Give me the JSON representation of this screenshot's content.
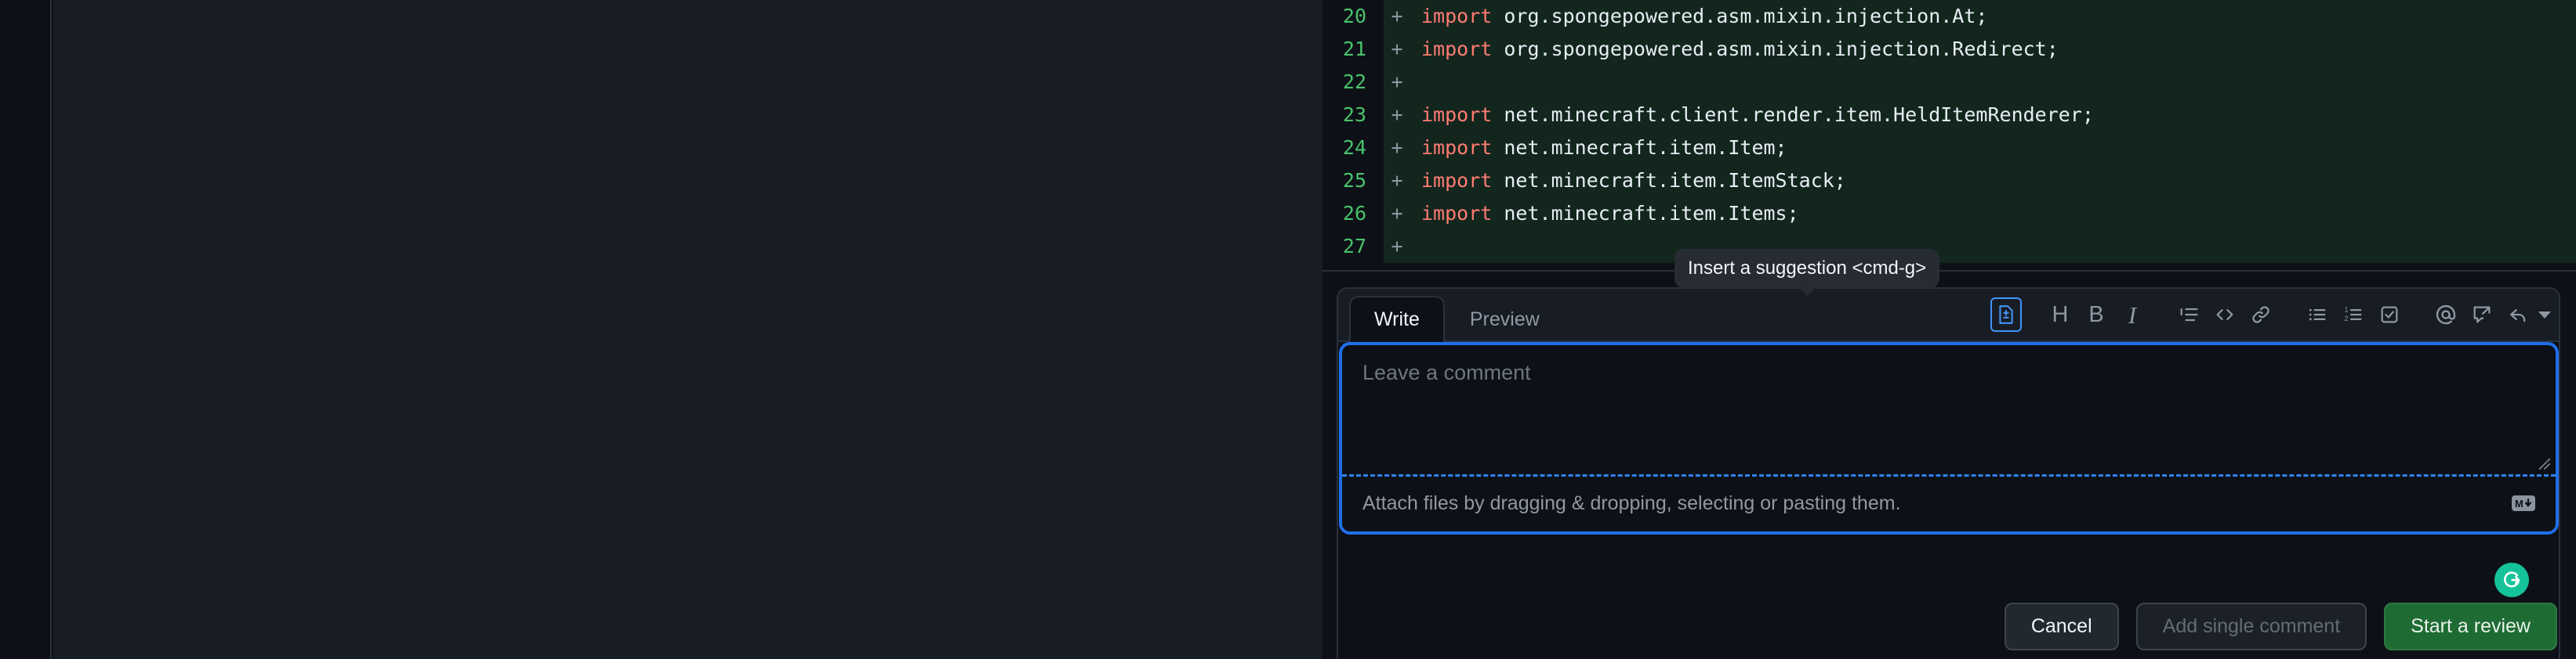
{
  "diff": {
    "lines": [
      {
        "num": "20",
        "marker": "+",
        "keyword": "import",
        "rest": " org.spongepowered.asm.mixin.injection.At;"
      },
      {
        "num": "21",
        "marker": "+",
        "keyword": "import",
        "rest": " org.spongepowered.asm.mixin.injection.Redirect;"
      },
      {
        "num": "22",
        "marker": "+",
        "keyword": "",
        "rest": ""
      },
      {
        "num": "23",
        "marker": "+",
        "keyword": "import",
        "rest": " net.minecraft.client.render.item.HeldItemRenderer;"
      },
      {
        "num": "24",
        "marker": "+",
        "keyword": "import",
        "rest": " net.minecraft.item.Item;"
      },
      {
        "num": "25",
        "marker": "+",
        "keyword": "import",
        "rest": " net.minecraft.item.ItemStack;"
      },
      {
        "num": "26",
        "marker": "+",
        "keyword": "import",
        "rest": " net.minecraft.item.Items;"
      },
      {
        "num": "27",
        "marker": "+",
        "keyword": "",
        "rest": ""
      }
    ]
  },
  "tooltip": {
    "text": "Insert a suggestion <cmd-g>"
  },
  "comment_form": {
    "tabs": [
      {
        "label": "Write",
        "active": true
      },
      {
        "label": "Preview",
        "active": false
      }
    ],
    "toolbar": [
      {
        "name": "insert-suggestion-icon",
        "title": "Insert a suggestion",
        "glyph": "suggestion"
      },
      {
        "name": "heading-icon",
        "title": "Heading",
        "glyph": "H"
      },
      {
        "name": "bold-icon",
        "title": "Bold",
        "glyph": "B"
      },
      {
        "name": "italic-icon",
        "title": "Italic",
        "glyph": "I"
      },
      {
        "name": "quote-icon",
        "title": "Quote",
        "glyph": "quote"
      },
      {
        "name": "code-icon",
        "title": "Code",
        "glyph": "code"
      },
      {
        "name": "link-icon",
        "title": "Link",
        "glyph": "link"
      },
      {
        "name": "unordered-list-icon",
        "title": "Unordered list",
        "glyph": "ul"
      },
      {
        "name": "ordered-list-icon",
        "title": "Numbered list",
        "glyph": "ol"
      },
      {
        "name": "task-list-icon",
        "title": "Task list",
        "glyph": "task"
      },
      {
        "name": "mention-icon",
        "title": "Mention",
        "glyph": "at"
      },
      {
        "name": "reference-icon",
        "title": "Reference",
        "glyph": "reference"
      },
      {
        "name": "saved-replies-icon",
        "title": "Saved replies",
        "glyph": "reply"
      }
    ],
    "textarea": {
      "placeholder": "Leave a comment",
      "value": ""
    },
    "attach_hint": "Attach files by dragging & dropping, selecting or pasting them.",
    "markdown_badge": "M",
    "grammarly_badge": "G",
    "buttons": [
      {
        "label": "Cancel",
        "kind": "default",
        "name": "cancel-button"
      },
      {
        "label": "Add single comment",
        "kind": "disabled",
        "name": "add-single-comment-button"
      },
      {
        "label": "Start a review",
        "kind": "primary",
        "name": "start-a-review-button"
      }
    ]
  },
  "colors": {
    "accent_blue": "#1f6feb",
    "addition_green": "#4ac26b",
    "primary_button_green": "#1f6b34",
    "grammarly_green": "#15c39a",
    "keyword_red": "#ff7b72"
  }
}
